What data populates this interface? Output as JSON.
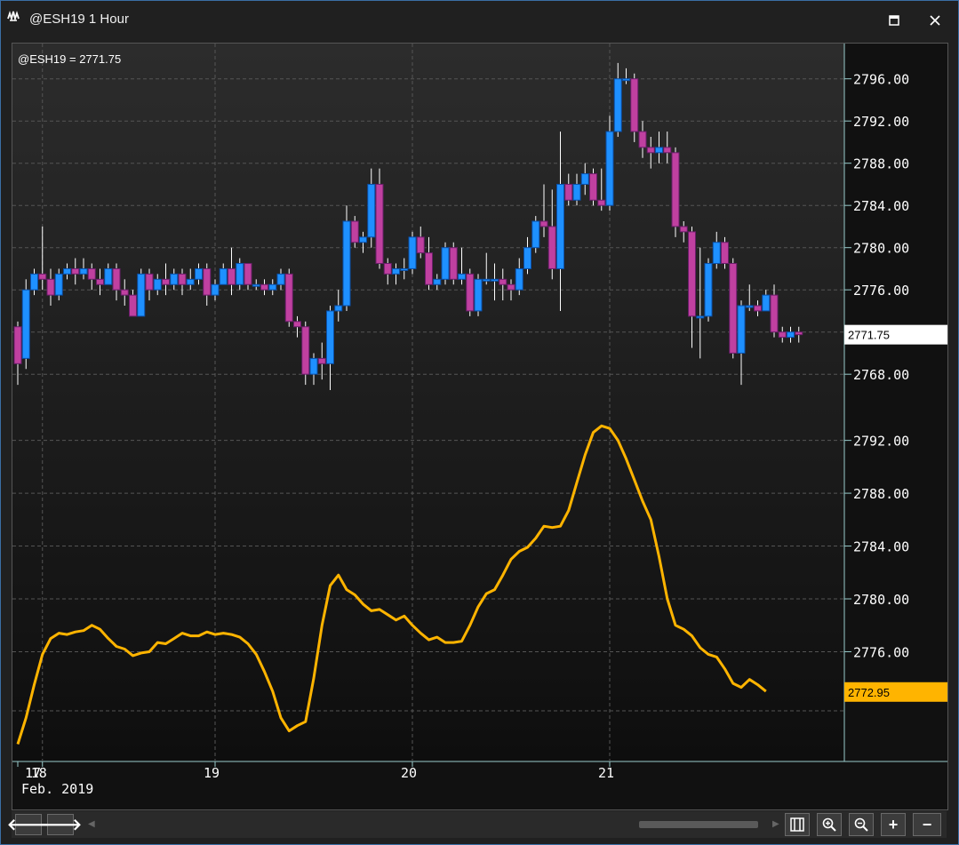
{
  "window": {
    "title": "@ESH19 1 Hour",
    "maximize_label": "🗖",
    "close_label": "✕"
  },
  "chart_data": [
    {
      "type": "candlestick",
      "title": "@ESH19 = 2771.75",
      "last_value_label": "2771.75",
      "y_ticks": [
        "2768.00",
        "2772.00",
        "2776.00",
        "2780.00",
        "2784.00",
        "2788.00",
        "2792.00",
        "2796.00"
      ],
      "ylim": [
        2766.5,
        2798.5
      ],
      "last_value": 2771.75,
      "candles": [
        [
          2772.5,
          2769.0,
          2767.0,
          2773.0
        ],
        [
          2769.5,
          2776.0,
          2768.5,
          2777.0
        ],
        [
          2776.0,
          2777.5,
          2775.5,
          2778.0
        ],
        [
          2777.5,
          2777.0,
          2776.0,
          2782.0
        ],
        [
          2777.0,
          2775.5,
          2774.5,
          2778.0
        ],
        [
          2775.5,
          2777.5,
          2775.0,
          2778.0
        ],
        [
          2777.5,
          2778.0,
          2777.0,
          2778.5
        ],
        [
          2778.0,
          2777.5,
          2776.5,
          2779.0
        ],
        [
          2777.5,
          2778.0,
          2777.0,
          2779.0
        ],
        [
          2778.0,
          2777.0,
          2776.0,
          2778.5
        ],
        [
          2777.0,
          2776.5,
          2775.5,
          2778.0
        ],
        [
          2776.5,
          2778.0,
          2776.5,
          2778.5
        ],
        [
          2778.0,
          2776.0,
          2775.0,
          2778.5
        ],
        [
          2776.0,
          2775.5,
          2774.5,
          2777.0
        ],
        [
          2775.5,
          2773.5,
          2773.5,
          2776.0
        ],
        [
          2773.5,
          2777.5,
          2773.5,
          2778.0
        ],
        [
          2777.5,
          2776.0,
          2775.0,
          2778.0
        ],
        [
          2776.0,
          2777.0,
          2775.5,
          2777.5
        ],
        [
          2777.0,
          2776.5,
          2775.5,
          2778.5
        ],
        [
          2776.5,
          2777.5,
          2776.0,
          2778.0
        ],
        [
          2777.5,
          2776.5,
          2775.5,
          2778.0
        ],
        [
          2776.5,
          2777.0,
          2776.0,
          2778.0
        ],
        [
          2777.0,
          2778.0,
          2776.5,
          2778.5
        ],
        [
          2778.0,
          2775.5,
          2774.5,
          2778.5
        ],
        [
          2775.5,
          2776.5,
          2775.0,
          2777.0
        ],
        [
          2776.5,
          2778.0,
          2776.5,
          2778.5
        ],
        [
          2778.0,
          2776.5,
          2775.5,
          2780.0
        ],
        [
          2776.5,
          2778.5,
          2776.0,
          2779.0
        ],
        [
          2778.5,
          2776.5,
          2776.0,
          2778.5
        ],
        [
          2776.5,
          2776.5,
          2776.0,
          2777.0
        ],
        [
          2776.5,
          2776.0,
          2775.5,
          2777.0
        ],
        [
          2776.0,
          2776.5,
          2775.5,
          2777.0
        ],
        [
          2776.5,
          2777.5,
          2776.0,
          2778.0
        ],
        [
          2777.5,
          2773.0,
          2772.5,
          2778.0
        ],
        [
          2773.0,
          2772.5,
          2771.5,
          2773.5
        ],
        [
          2772.5,
          2768.0,
          2767.0,
          2773.0
        ],
        [
          2768.0,
          2769.5,
          2767.0,
          2770.0
        ],
        [
          2769.5,
          2769.0,
          2767.5,
          2771.0
        ],
        [
          2769.0,
          2774.0,
          2766.5,
          2774.5
        ],
        [
          2774.0,
          2774.5,
          2773.0,
          2776.0
        ],
        [
          2774.5,
          2782.5,
          2774.0,
          2784.0
        ],
        [
          2782.5,
          2780.5,
          2780.0,
          2783.0
        ],
        [
          2780.5,
          2781.0,
          2779.5,
          2781.5
        ],
        [
          2781.0,
          2786.0,
          2780.0,
          2787.5
        ],
        [
          2786.0,
          2778.5,
          2778.0,
          2787.5
        ],
        [
          2778.5,
          2777.5,
          2776.5,
          2779.0
        ],
        [
          2777.5,
          2778.0,
          2776.5,
          2778.5
        ],
        [
          2778.0,
          2778.0,
          2777.0,
          2779.0
        ],
        [
          2778.0,
          2781.0,
          2777.5,
          2781.5
        ],
        [
          2781.0,
          2779.5,
          2779.0,
          2782.0
        ],
        [
          2779.5,
          2776.5,
          2776.0,
          2781.0
        ],
        [
          2776.5,
          2777.0,
          2776.0,
          2777.5
        ],
        [
          2777.0,
          2780.0,
          2776.5,
          2780.5
        ],
        [
          2780.0,
          2777.0,
          2776.5,
          2780.5
        ],
        [
          2777.0,
          2777.5,
          2776.5,
          2780.0
        ],
        [
          2777.5,
          2774.0,
          2773.5,
          2778.0
        ],
        [
          2774.0,
          2777.0,
          2773.5,
          2777.5
        ],
        [
          2777.0,
          2777.0,
          2776.5,
          2779.5
        ],
        [
          2777.0,
          2777.0,
          2775.0,
          2778.5
        ],
        [
          2777.0,
          2776.5,
          2775.0,
          2778.0
        ],
        [
          2776.5,
          2776.0,
          2775.0,
          2777.0
        ],
        [
          2776.0,
          2778.0,
          2775.5,
          2779.0
        ],
        [
          2778.0,
          2780.0,
          2777.5,
          2781.0
        ],
        [
          2780.0,
          2782.5,
          2779.5,
          2783.0
        ],
        [
          2782.5,
          2782.0,
          2781.0,
          2786.0
        ],
        [
          2782.0,
          2778.0,
          2777.0,
          2785.5
        ],
        [
          2778.0,
          2786.0,
          2774.0,
          2791.0
        ],
        [
          2786.0,
          2784.5,
          2784.0,
          2787.0
        ],
        [
          2784.5,
          2786.0,
          2784.0,
          2787.0
        ],
        [
          2786.0,
          2787.0,
          2785.0,
          2788.0
        ],
        [
          2787.0,
          2784.5,
          2784.0,
          2787.5
        ],
        [
          2784.5,
          2784.0,
          2783.5,
          2787.5
        ],
        [
          2784.0,
          2791.0,
          2783.5,
          2792.5
        ],
        [
          2791.0,
          2796.0,
          2790.5,
          2797.5
        ],
        [
          2796.0,
          2796.0,
          2795.5,
          2797.0
        ],
        [
          2796.0,
          2791.0,
          2790.0,
          2796.5
        ],
        [
          2791.0,
          2789.5,
          2788.5,
          2792.0
        ],
        [
          2789.5,
          2789.0,
          2787.5,
          2790.5
        ],
        [
          2789.0,
          2789.5,
          2788.0,
          2791.0
        ],
        [
          2789.5,
          2789.0,
          2788.0,
          2791.0
        ],
        [
          2789.0,
          2782.0,
          2781.0,
          2789.5
        ],
        [
          2782.0,
          2781.5,
          2780.5,
          2782.5
        ],
        [
          2781.5,
          2773.5,
          2770.5,
          2782.0
        ],
        [
          2773.5,
          2773.5,
          2769.5,
          2780.0
        ],
        [
          2773.5,
          2778.5,
          2773.0,
          2779.0
        ],
        [
          2778.5,
          2780.5,
          2778.0,
          2781.5
        ],
        [
          2780.5,
          2778.5,
          2778.0,
          2781.0
        ],
        [
          2778.5,
          2770.0,
          2769.5,
          2779.0
        ],
        [
          2770.0,
          2774.5,
          2767.0,
          2775.0
        ],
        [
          2774.5,
          2774.5,
          2774.0,
          2776.5
        ],
        [
          2774.5,
          2774.0,
          2773.5,
          2775.0
        ],
        [
          2774.0,
          2775.5,
          2774.0,
          2776.0
        ],
        [
          2775.5,
          2772.0,
          2771.5,
          2776.5
        ],
        [
          2772.0,
          2771.5,
          2771.0,
          2772.5
        ],
        [
          2771.5,
          2772.0,
          2771.0,
          2772.5
        ],
        [
          2772.0,
          2771.75,
          2771.0,
          2772.5
        ]
      ]
    },
    {
      "type": "line",
      "title": "",
      "last_value_label": "2772.95",
      "y_ticks": [
        "2776.00",
        "2780.00",
        "2784.00",
        "2788.00",
        "2792.00"
      ],
      "ylim": [
        2768.9,
        2794.8
      ],
      "last_value": 2772.95,
      "values": [
        2769.0,
        2771.0,
        2773.5,
        2775.8,
        2777.0,
        2777.4,
        2777.3,
        2777.5,
        2777.6,
        2778.0,
        2777.7,
        2777.0,
        2776.4,
        2776.2,
        2775.7,
        2775.9,
        2776.0,
        2776.7,
        2776.6,
        2777.0,
        2777.4,
        2777.2,
        2777.2,
        2777.5,
        2777.3,
        2777.4,
        2777.3,
        2777.1,
        2776.6,
        2775.8,
        2774.5,
        2773.0,
        2771.0,
        2770.0,
        2770.4,
        2770.7,
        2774.0,
        2778.0,
        2781.0,
        2781.8,
        2780.7,
        2780.3,
        2779.6,
        2779.1,
        2779.2,
        2778.8,
        2778.4,
        2778.7,
        2778.0,
        2777.4,
        2776.9,
        2777.1,
        2776.7,
        2776.7,
        2776.8,
        2778.0,
        2779.4,
        2780.4,
        2780.7,
        2781.8,
        2783.0,
        2783.6,
        2783.9,
        2784.6,
        2785.5,
        2785.4,
        2785.5,
        2786.7,
        2788.8,
        2790.9,
        2792.6,
        2793.1,
        2792.9,
        2792.0,
        2790.6,
        2789.0,
        2787.4,
        2786.0,
        2783.2,
        2780.0,
        2778.0,
        2777.7,
        2777.2,
        2776.3,
        2775.8,
        2775.6,
        2774.7,
        2773.6,
        2773.3,
        2773.9,
        2773.5,
        2773.0
      ]
    }
  ],
  "x_axis": {
    "ticks": [
      {
        "label": "17",
        "index": 0
      },
      {
        "label": "18",
        "index": 3
      },
      {
        "label": "19",
        "index": 24
      },
      {
        "label": "20",
        "index": 48
      },
      {
        "label": "21",
        "index": 72
      }
    ],
    "month_label": "Feb. 2019"
  },
  "colors": {
    "up_body": "#1e90ff",
    "down_body": "#c040a0",
    "wick": "#ffffff",
    "line": "#ffb400",
    "grid": "#555555",
    "axis_text": "#ffffff",
    "price_tag_bg": "#ffffff",
    "line_tag_bg": "#ffb400"
  },
  "toolbar": {
    "back_label": "🡐",
    "forward_label": "🡒",
    "plus_label": "+",
    "minus_label": "−"
  }
}
